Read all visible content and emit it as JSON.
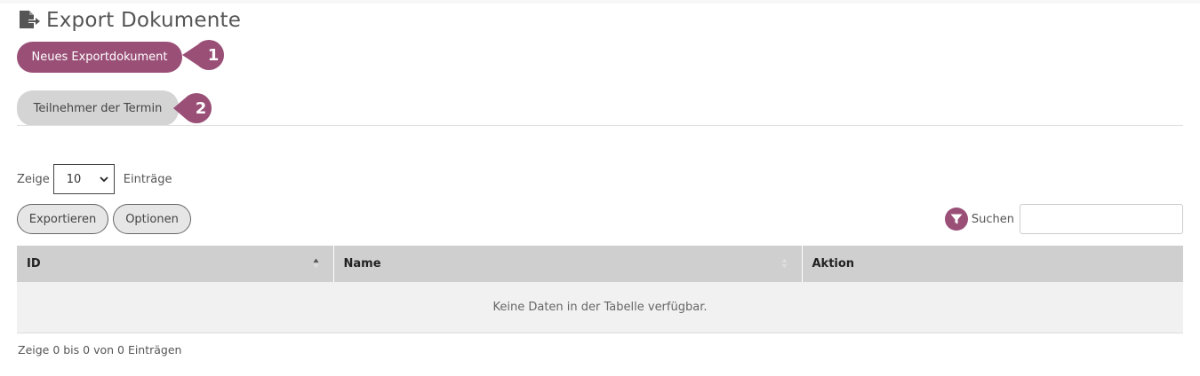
{
  "page": {
    "title": "Export Dokumente",
    "title_icon": "file-export-icon"
  },
  "actions": {
    "new_export_label": "Neues Exportdokument",
    "callout_1": "1"
  },
  "tabs": {
    "participants_label": "Teilnehmer der Termin",
    "callout_2": "2"
  },
  "table_controls": {
    "show_prefix": "Zeige",
    "page_size": "10",
    "show_suffix": "Einträge",
    "export_label": "Exportieren",
    "options_label": "Optionen",
    "search_label": "Suchen",
    "search_value": "",
    "filter_icon": "filter-icon"
  },
  "table": {
    "columns": [
      "ID",
      "Name",
      "Aktion"
    ],
    "empty_text": "Keine Daten in der Tabelle verfügbar."
  },
  "footer": {
    "info": "Zeige 0 bis 0 von 0 Einträgen"
  },
  "colors": {
    "accent": "#9a4f77",
    "pill_gray": "#d4d4d4",
    "table_header": "#cfcfcf",
    "table_body": "#f1f1f1"
  }
}
